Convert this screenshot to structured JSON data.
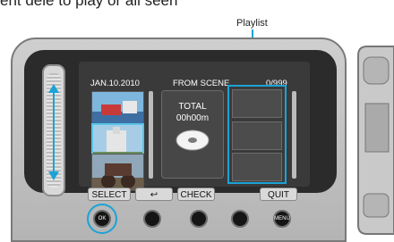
{
  "instruction_text": "ent dele to play or all seen",
  "playlist_label": "Playlist",
  "screen": {
    "date": "JAN.10.2010",
    "mode": "FROM SCENE",
    "counter": "0/999",
    "total_label": "TOTAL",
    "total_time": "00h00m"
  },
  "softkeys": {
    "select": "SELECT",
    "back": "↩",
    "check": "CHECK",
    "quit": "QUIT"
  },
  "buttons": {
    "ok": "OK",
    "menu": "MENU"
  },
  "colors": {
    "highlight": "#1ba3d6"
  }
}
